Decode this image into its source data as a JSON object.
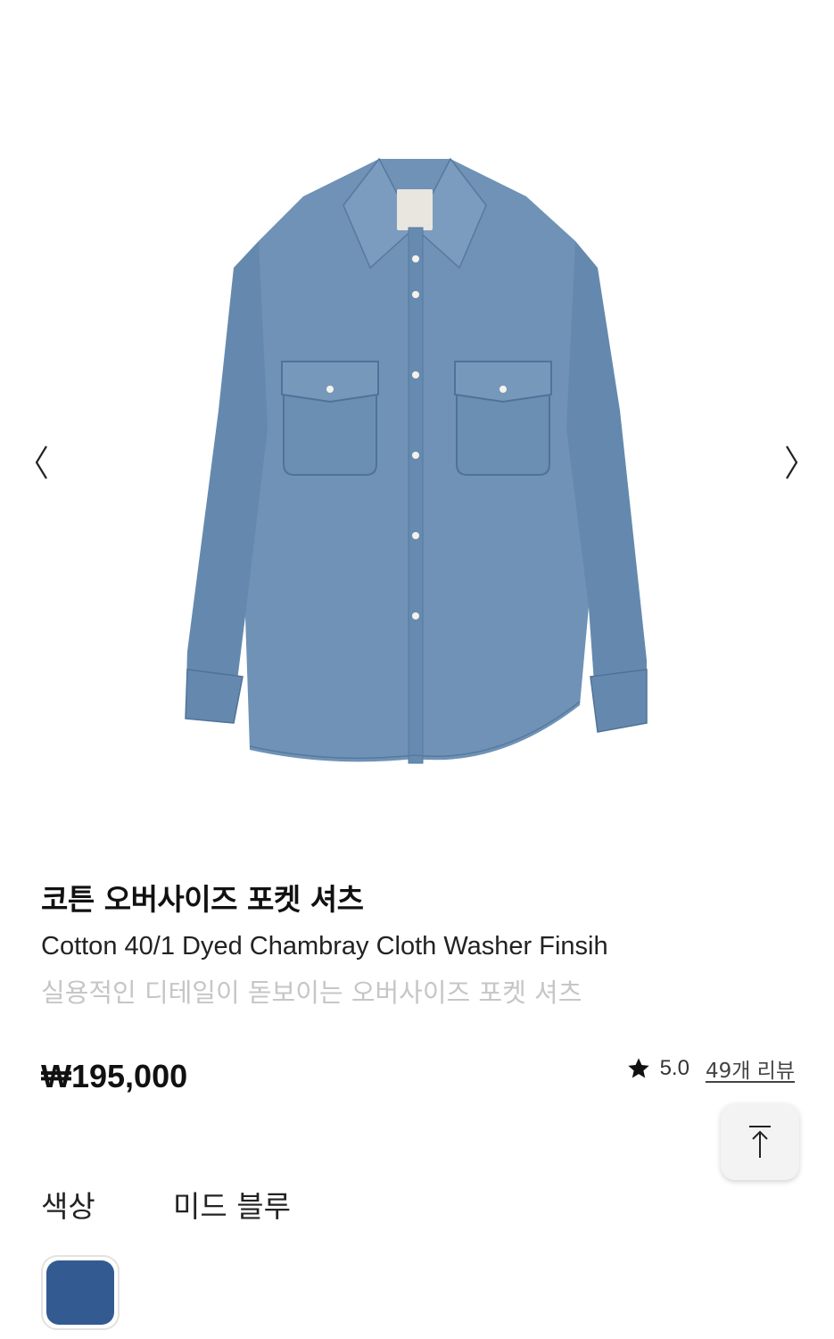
{
  "product": {
    "name_ko": "코튼 오버사이즈 포켓 셔츠",
    "name_en": "Cotton 40/1 Dyed Chambray Cloth Washer Finsih",
    "description": "실용적인 디테일이 돋보이는 오버사이즈 포켓 셔츠",
    "price": "₩195,000"
  },
  "rating": {
    "score": "5.0",
    "reviews_link": "49개 리뷰",
    "star_icon": "star-icon"
  },
  "color": {
    "label": "색상",
    "selected_name": "미드 블루",
    "swatch_hex": "#345a92"
  },
  "gallery": {
    "prev_icon": "chevron-left-icon",
    "next_icon": "chevron-right-icon"
  },
  "scroll_top_icon": "arrow-up-to-top-icon",
  "colors": {
    "shirt": "#7092b5",
    "shirt_dark": "#5c7fa3",
    "shirt_light": "#86a5c4"
  }
}
